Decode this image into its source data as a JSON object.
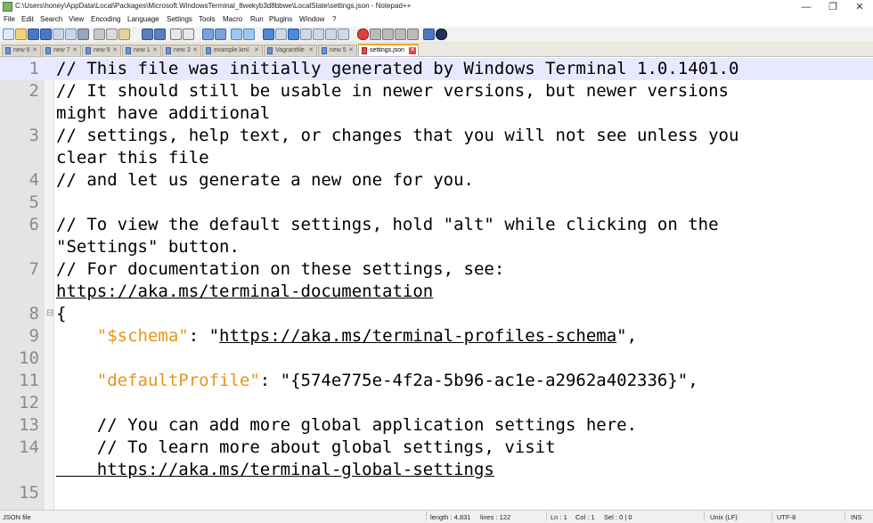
{
  "window": {
    "title": "C:\\Users\\honey\\AppData\\Local\\Packages\\Microsoft.WindowsTerminal_8wekyb3d8bbwe\\LocalState\\settings.json - Notepad++",
    "minimize": "—",
    "maximize": "❐",
    "close": "✕"
  },
  "menu": [
    "File",
    "Edit",
    "Search",
    "View",
    "Encoding",
    "Language",
    "Settings",
    "Tools",
    "Macro",
    "Run",
    "Plugins",
    "Window",
    "?"
  ],
  "tabs": [
    {
      "label": "new 6"
    },
    {
      "label": "new 7"
    },
    {
      "label": "new 9"
    },
    {
      "label": "new 1"
    },
    {
      "label": "new 3"
    },
    {
      "label": "example.kml"
    },
    {
      "label": "Vagrantfile"
    },
    {
      "label": "new 5"
    },
    {
      "label": "settings.json"
    }
  ],
  "editor": {
    "lines": [
      {
        "num": "1",
        "segments": [
          {
            "t": "// This file was initially generated by Windows Terminal 1.0.1401.0"
          }
        ]
      },
      {
        "num": "2",
        "segments": [
          {
            "t": "// It should still be usable in newer versions, but newer versions"
          }
        ]
      },
      {
        "num": "",
        "segments": [
          {
            "t": "might have additional"
          }
        ]
      },
      {
        "num": "3",
        "segments": [
          {
            "t": "// settings, help text, or changes that you will not see unless you"
          }
        ]
      },
      {
        "num": "",
        "segments": [
          {
            "t": "clear this file"
          }
        ]
      },
      {
        "num": "4",
        "segments": [
          {
            "t": "// and let us generate a new one for you."
          }
        ]
      },
      {
        "num": "5",
        "segments": [
          {
            "t": ""
          }
        ]
      },
      {
        "num": "6",
        "segments": [
          {
            "t": "// To view the default settings, hold \"alt\" while clicking on the"
          }
        ]
      },
      {
        "num": "",
        "segments": [
          {
            "t": "\"Settings\" button."
          }
        ]
      },
      {
        "num": "7",
        "segments": [
          {
            "t": "// For documentation on these settings, see:"
          }
        ]
      },
      {
        "num": "",
        "segments": [
          {
            "t": "https://aka.ms/terminal-documentation"
          }
        ]
      },
      {
        "num": "8",
        "segments": [
          {
            "t": "{"
          }
        ]
      },
      {
        "num": "9",
        "segments": [
          {
            "t": "    "
          },
          {
            "t": "\"$schema\""
          },
          {
            "t": ": \""
          },
          {
            "t": "https://aka.ms/terminal-profiles-schema"
          },
          {
            "t": "\","
          }
        ]
      },
      {
        "num": "10",
        "segments": [
          {
            "t": ""
          }
        ]
      },
      {
        "num": "11",
        "segments": [
          {
            "t": "    "
          },
          {
            "t": "\"defaultProfile\""
          },
          {
            "t": ": \"{574e775e-4f2a-5b96-ac1e-a2962a402336}\","
          }
        ]
      },
      {
        "num": "12",
        "segments": [
          {
            "t": ""
          }
        ]
      },
      {
        "num": "13",
        "segments": [
          {
            "t": "    // You can add more global application settings here."
          }
        ]
      },
      {
        "num": "14",
        "segments": [
          {
            "t": "    // To learn more about global settings, visit"
          }
        ]
      },
      {
        "num": "",
        "segments": [
          {
            "t": "    https://aka.ms/terminal-global-settings"
          }
        ]
      },
      {
        "num": "15",
        "segments": [
          {
            "t": ""
          }
        ]
      }
    ]
  },
  "status": {
    "file_type": "JSON file",
    "length": "length : 4,831",
    "lines": "lines : 122",
    "ln": "Ln : 1",
    "col": "Col : 1",
    "sel": "Sel : 0 | 0",
    "eol": "Unix (LF)",
    "encoding": "UTF-8",
    "mode": "INS"
  },
  "colors": {
    "key_orange": "#e8941a",
    "current_line": "#e8e8ff",
    "active_tab_accent": "#f5a623"
  }
}
